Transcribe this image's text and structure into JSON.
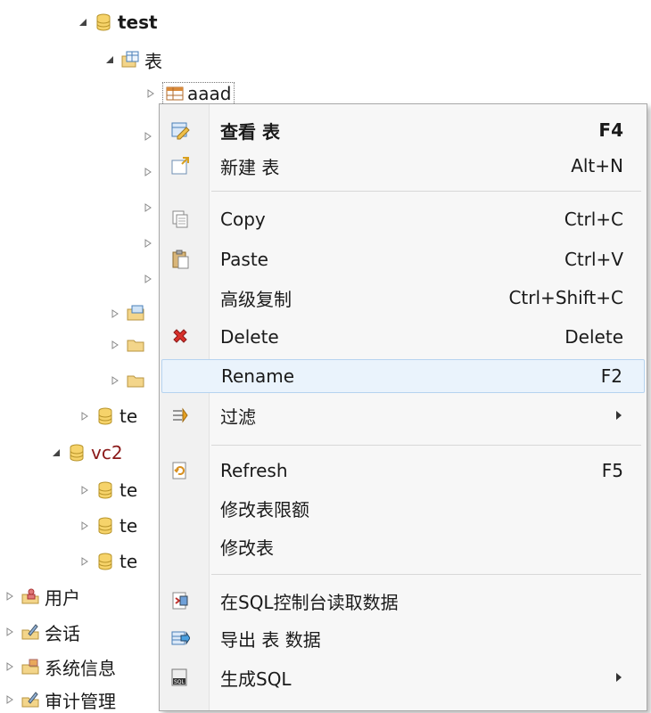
{
  "tree": {
    "db_test": "test",
    "tables_folder": "表",
    "table_aaad": "aaad",
    "te1": "te",
    "db_vc2": "vc2",
    "vc2_children": [
      "te",
      "te",
      "te"
    ],
    "users": "用户",
    "sessions": "会话",
    "sysinfo": "系统信息",
    "audit": "审计管理"
  },
  "menu": {
    "view": {
      "label": "查看 表",
      "key": "F4"
    },
    "new": {
      "label": "新建 表",
      "key": "Alt+N"
    },
    "copy": {
      "label": "Copy",
      "key": "Ctrl+C"
    },
    "paste": {
      "label": "Paste",
      "key": "Ctrl+V"
    },
    "adv_copy": {
      "label": "高级复制",
      "key": "Ctrl+Shift+C"
    },
    "delete": {
      "label": "Delete",
      "key": "Delete"
    },
    "rename": {
      "label": "Rename",
      "key": "F2"
    },
    "filter": {
      "label": "过滤"
    },
    "refresh": {
      "label": "Refresh",
      "key": "F5"
    },
    "quota": {
      "label": "修改表限额"
    },
    "alter": {
      "label": "修改表"
    },
    "sql_read": {
      "label": "在SQL控制台读取数据"
    },
    "export": {
      "label": "导出 表 数据"
    },
    "gen_sql": {
      "label": "生成SQL"
    }
  }
}
